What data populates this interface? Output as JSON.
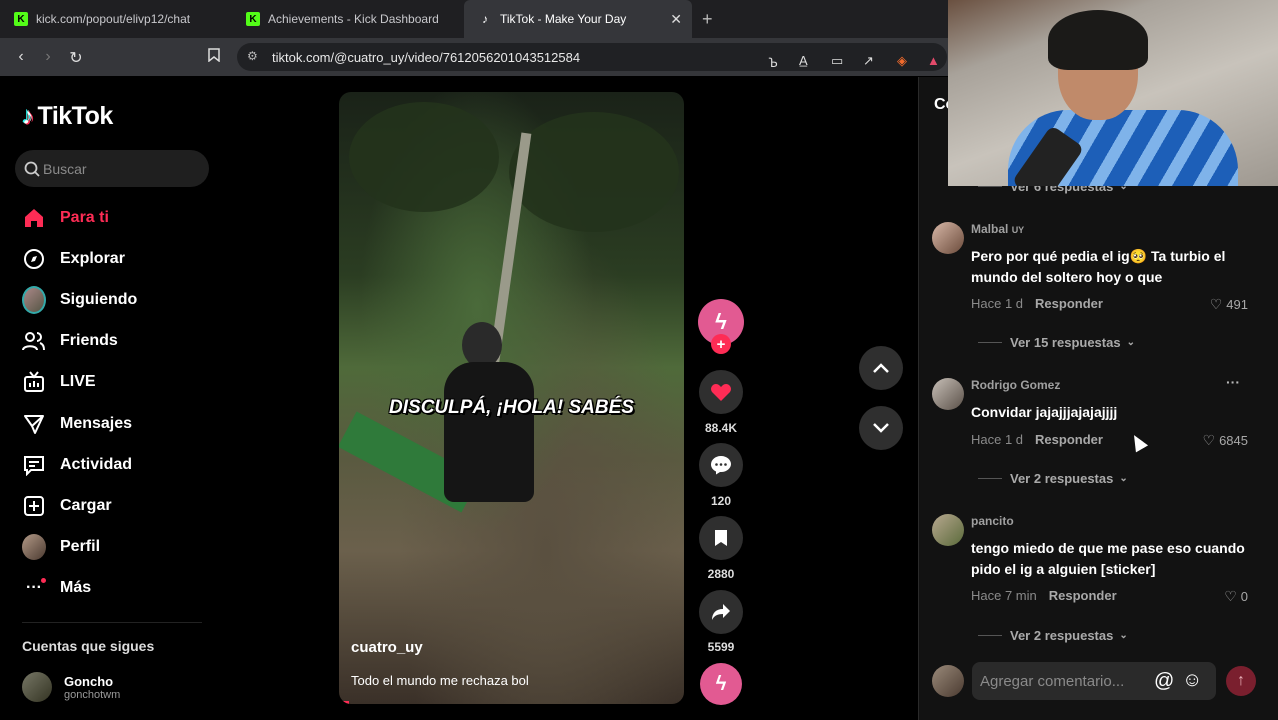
{
  "browser": {
    "tabs": [
      {
        "label": "kick.com/popout/elivp12/chat",
        "favicon": "kick-icon",
        "active": false
      },
      {
        "label": "Achievements - Kick Dashboard",
        "favicon": "kick-icon",
        "active": false
      },
      {
        "label": "TikTok - Make Your Day",
        "favicon": "tiktok-icon",
        "active": true
      }
    ],
    "new_tab": "+",
    "close": "✕",
    "url": "tiktok.com/@cuatro_uy/video/7612056201043512584"
  },
  "sidebar": {
    "logo_text": "TikTok",
    "search_placeholder": "Buscar",
    "items": [
      {
        "label": "Para ti",
        "icon": "home-icon",
        "active": true
      },
      {
        "label": "Explorar",
        "icon": "compass-icon",
        "active": false
      },
      {
        "label": "Siguiendo",
        "icon": "avatar-icon",
        "active": false
      },
      {
        "label": "Friends",
        "icon": "friends-icon",
        "active": false
      },
      {
        "label": "LIVE",
        "icon": "live-icon",
        "active": false
      },
      {
        "label": "Mensajes",
        "icon": "send-icon",
        "active": false
      },
      {
        "label": "Actividad",
        "icon": "activity-icon",
        "active": false
      },
      {
        "label": "Cargar",
        "icon": "upload-icon",
        "active": false
      },
      {
        "label": "Perfil",
        "icon": "profile-icon",
        "active": false
      },
      {
        "label": "Más",
        "icon": "more-icon",
        "active": false
      }
    ],
    "following_title": "Cuentas que sigues",
    "following": [
      {
        "name": "Goncho",
        "handle": "gonchotwm"
      }
    ]
  },
  "video": {
    "overlay_caption": "DISCULPÁ, ¡HOLA! SABÉS",
    "username": "cuatro_uy",
    "description": "Todo el mundo me rechaza bol",
    "progress": 0.03
  },
  "actions": {
    "author_initial": "ϟ",
    "follow": "+",
    "likes": "88.4K",
    "comments": "120",
    "saves": "2880",
    "shares": "5599"
  },
  "comments_panel": {
    "title": "Co",
    "top_replies": "Ver 6 respuestas",
    "comments": [
      {
        "user": "Malbal",
        "flag": "UY",
        "text": "Pero por qué pedia el ig🥺 Ta turbio el mundo del soltero hoy o que",
        "time": "Hace 1 d",
        "reply": "Responder",
        "likes": "491",
        "replies": "Ver 15 respuestas"
      },
      {
        "user": "Rodrigo Gomez",
        "flag": "",
        "text": "Convidar jajajjjajajajjjj",
        "time": "Hace 1 d",
        "reply": "Responder",
        "likes": "6845",
        "replies": "Ver 2 respuestas"
      },
      {
        "user": "pancito",
        "flag": "",
        "text": "tengo miedo de que me pase eso cuando pido el ig a alguien [sticker]",
        "time": "Hace 7 min",
        "reply": "Responder",
        "likes": "0",
        "replies": "Ver 2 respuestas"
      }
    ],
    "composer_placeholder": "Agregar comentario...",
    "at_symbol": "@",
    "emoji_symbol": "☺",
    "send_symbol": "↑"
  },
  "colors": {
    "accent": "#fe2c55",
    "panel": "#121212",
    "chrome": "#35363a"
  }
}
